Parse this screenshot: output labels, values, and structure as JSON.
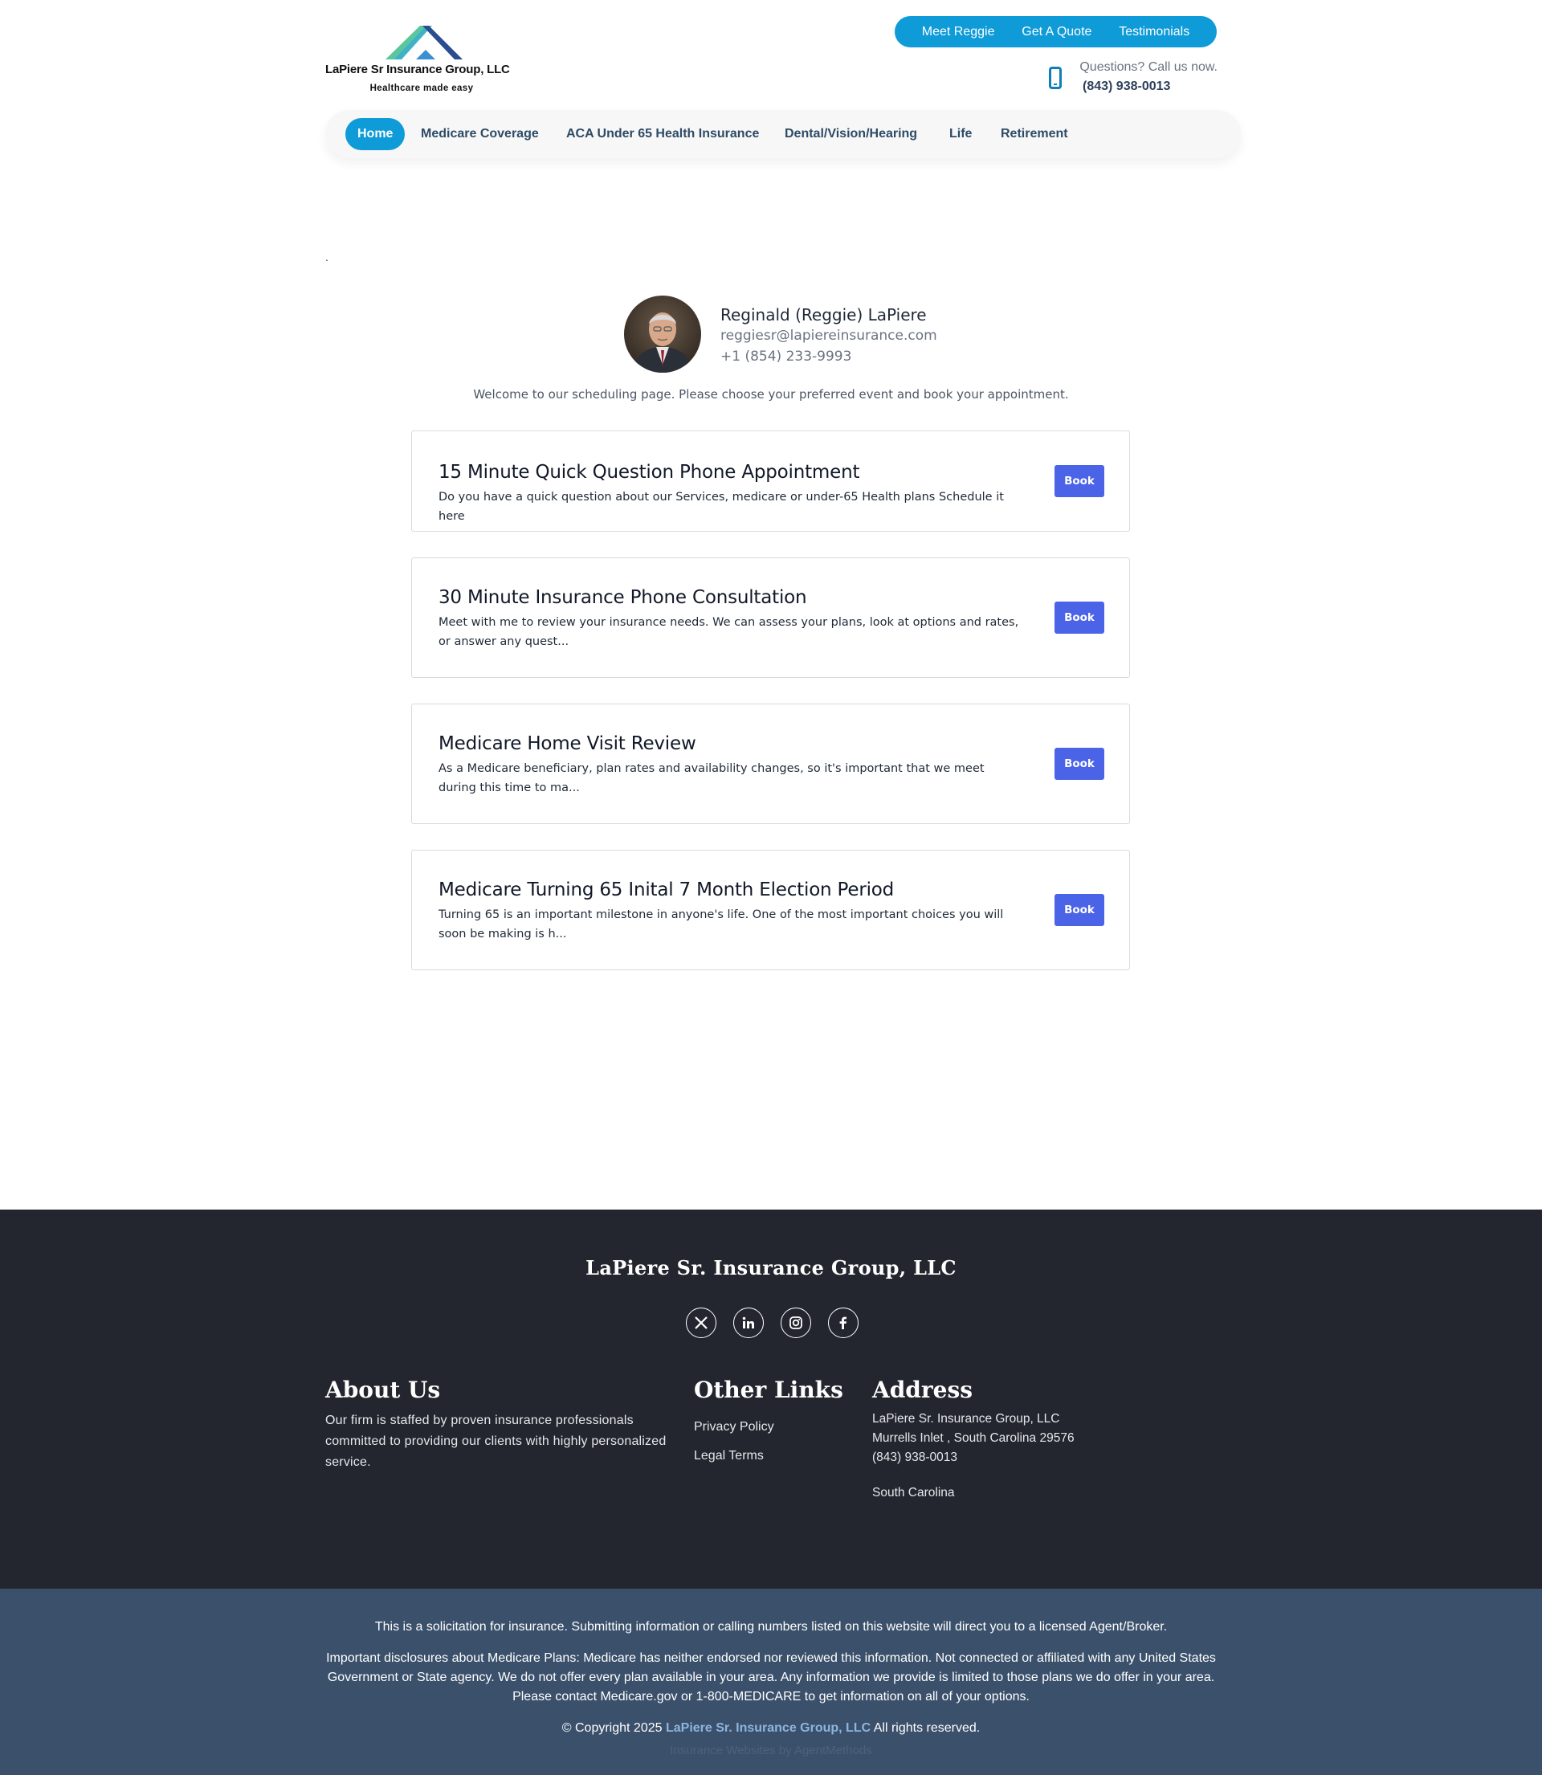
{
  "header": {
    "logo_name": "LaPiere Sr Insurance Group, LLC",
    "logo_tagline": "Healthcare made easy",
    "top_links": [
      "Meet Reggie",
      "Get A Quote",
      "Testimonials"
    ],
    "phone_prompt": "Questions? Call us now.",
    "phone_number": "(843) 938-0013"
  },
  "nav": {
    "items": [
      "Home",
      "Medicare Coverage",
      "ACA Under 65 Health Insurance",
      "Dental/Vision/Hearing",
      "Life",
      "Retirement"
    ],
    "active": "Home"
  },
  "stray_text": ".",
  "profile": {
    "name": "Reginald (Reggie) LaPiere",
    "email": "reggiesr@lapiereinsurance.com",
    "phone": "+1 (854) 233-9993",
    "welcome": "Welcome to our scheduling page. Please choose your preferred event and book your appointment."
  },
  "events": [
    {
      "title": "15 Minute Quick Question Phone Appointment",
      "description": "Do you have a quick question about our Services, medicare or under-65 Health plans Schedule it here",
      "button": "Book"
    },
    {
      "title": "30 Minute Insurance Phone Consultation",
      "description": "Meet with me to review your insurance needs. We can assess your plans, look at options and rates, or answer any quest...",
      "button": "Book"
    },
    {
      "title": "Medicare Home Visit Review",
      "description": "As a Medicare beneficiary, plan rates and availability changes, so it's important that we meet during this time to ma...",
      "button": "Book"
    },
    {
      "title": "Medicare Turning 65 Inital 7 Month Election Period",
      "description": "Turning 65 is an important milestone in anyone's life. One of the most important choices you will soon be making is h...",
      "button": "Book"
    }
  ],
  "footer": {
    "brand": "LaPiere Sr. Insurance Group, LLC",
    "social": [
      "x-icon",
      "linkedin-icon",
      "instagram-icon",
      "facebook-icon"
    ],
    "about_heading": "About Us",
    "about_text": "Our firm is staffed by proven insurance professionals committed to providing our clients with highly personalized service.",
    "links_heading": "Other Links",
    "links": [
      "Privacy Policy",
      "Legal Terms"
    ],
    "address_heading": "Address",
    "address_lines": [
      "LaPiere Sr. Insurance Group, LLC",
      "Murrells Inlet , South Carolina 29576",
      "(843) 938-0013"
    ],
    "address_state": "South Carolina"
  },
  "disclaimer": {
    "solicitation": "This is a solicitation for insurance. Submitting information or calling numbers listed on this website will direct you to a licensed Agent/Broker.",
    "medicare": "Important disclosures about Medicare Plans: Medicare has neither endorsed nor reviewed this information. Not connected or affiliated with any United States Government or State agency. We do not offer every plan available in your area. Any information we provide is limited to those plans we do offer in your area. Please contact Medicare.gov or 1-800-MEDICARE to get information on all of your options.",
    "copyright_prefix": "© Copyright 2025",
    "copyright_brand": "LaPiere Sr. Insurance Group, LLC",
    "copyright_suffix": "All rights reserved.",
    "credit": "Insurance Websites by AgentMethods"
  },
  "colors": {
    "primary_blue": "#0e9bd8",
    "book_button": "#4b63e6",
    "footer_bg": "#23262e",
    "disclaimer_bg": "#3b506b"
  }
}
